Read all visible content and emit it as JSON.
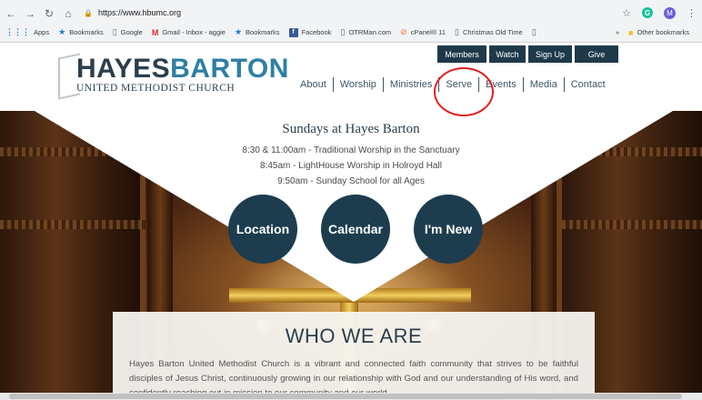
{
  "browser": {
    "url": "https://www.hbumc.org",
    "avatar_letter": "M",
    "grammarly_letter": "G",
    "bookmarks": [
      {
        "label": "Apps",
        "icon": "apps-grid-icon",
        "glyph": "⋮⋮⋮"
      },
      {
        "label": "Bookmarks",
        "icon": "star-icon",
        "glyph": "★"
      },
      {
        "label": "Google",
        "icon": "page-icon",
        "glyph": "▯"
      },
      {
        "label": "Gmail - Inbox - aggie",
        "icon": "gmail-icon",
        "glyph": "M"
      },
      {
        "label": "Bookmarks",
        "icon": "star-icon",
        "glyph": "★"
      },
      {
        "label": "Facebook",
        "icon": "facebook-icon",
        "glyph": "f"
      },
      {
        "label": "OTRMan.com",
        "icon": "page-icon",
        "glyph": "▯"
      },
      {
        "label": "cPanel® 11",
        "icon": "cpanel-icon",
        "glyph": "⊘"
      },
      {
        "label": "Christmas Old Time",
        "icon": "page-icon",
        "glyph": "▯"
      },
      {
        "label": "",
        "icon": "page-icon",
        "glyph": "▯"
      }
    ],
    "overflow": "»",
    "other_bookmarks": "Other bookmarks"
  },
  "site": {
    "logo": {
      "part1": "HAYES",
      "part2": "BARTON",
      "subtitle": "UNITED METHODIST CHURCH"
    },
    "utility_nav": [
      "Members",
      "Watch",
      "Sign Up",
      "Give"
    ],
    "main_nav": [
      "About",
      "Worship",
      "Ministries",
      "Serve",
      "Events",
      "Media",
      "Contact"
    ],
    "hero": {
      "title": "Sundays at Hayes Barton",
      "lines": [
        "8:30 & 11:00am - Traditional Worship in the Sanctuary",
        "8:45am - LightHouse Worship in Holroyd Hall",
        "9:50am - Sunday School for all Ages"
      ],
      "buttons": [
        "Location",
        "Calendar",
        "I'm New"
      ]
    },
    "who": {
      "title": "WHO WE ARE",
      "text": "Hayes Barton United Methodist Church is a vibrant and connected faith community that strives to be faithful disciples of Jesus Christ, continuously growing in our relationship with God and our understanding of His word, and confidently reaching out in mission to our community and our world."
    }
  }
}
